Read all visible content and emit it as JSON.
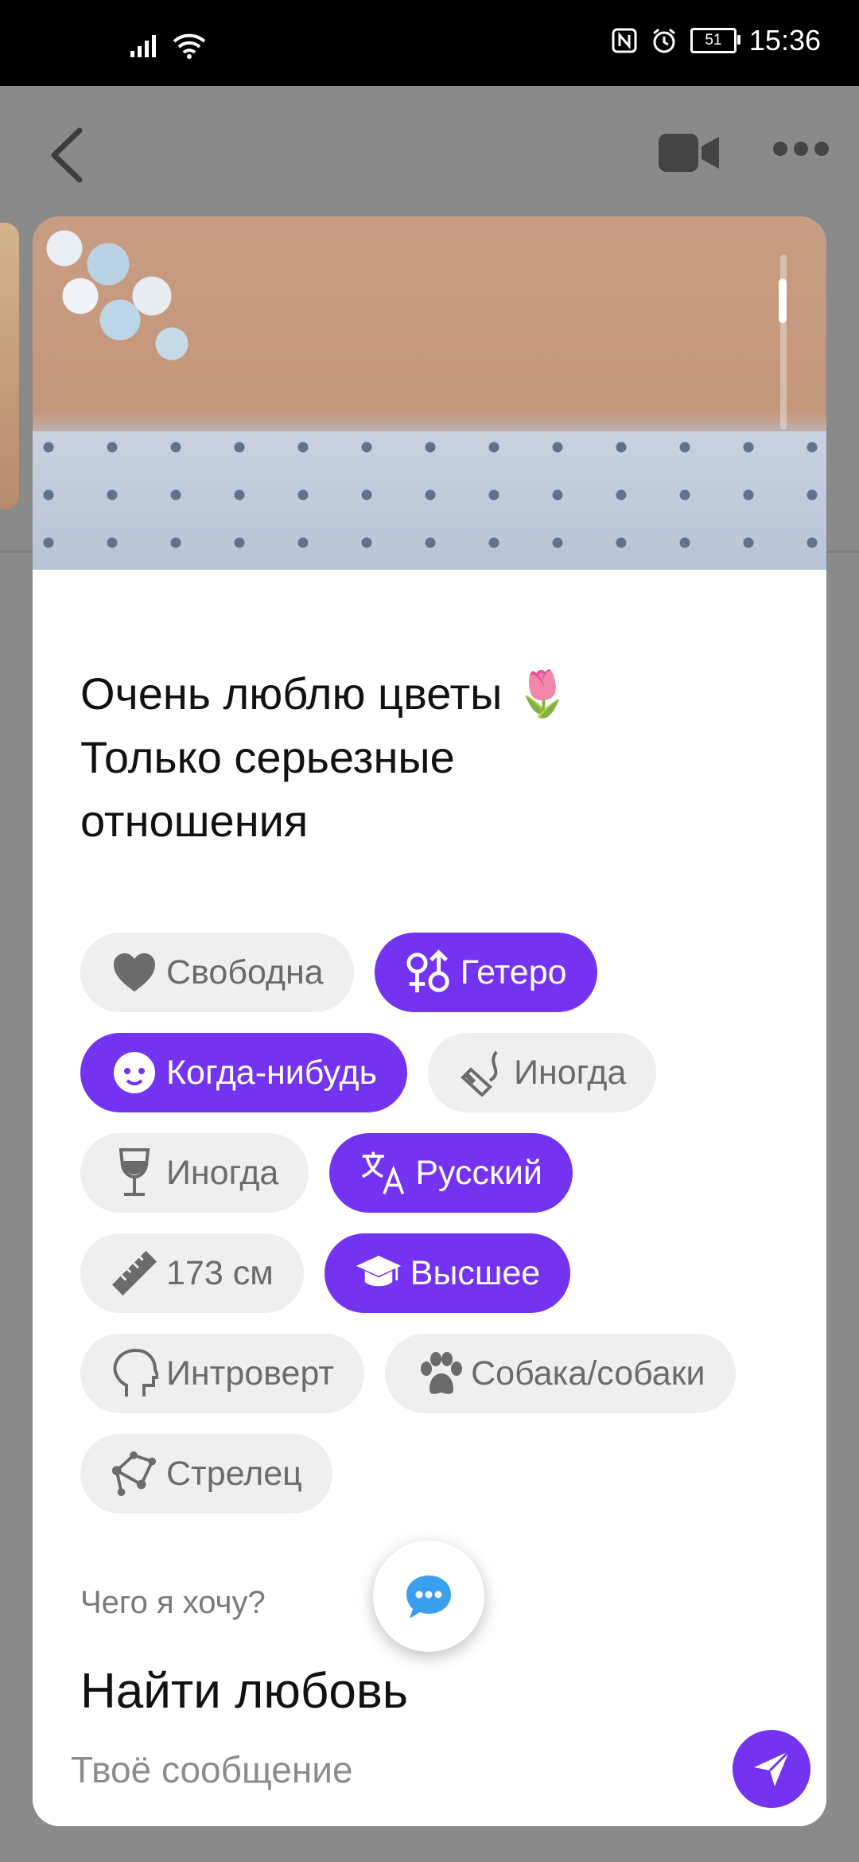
{
  "status_bar": {
    "time": "15:36",
    "battery_level": "51"
  },
  "profile": {
    "bio": "Очень люблю цветы 🌷\nТолько серьезные\nотношения",
    "tags": [
      {
        "label": "Свободна",
        "icon": "heart-icon",
        "highlighted": false
      },
      {
        "label": "Гетеро",
        "icon": "gender-icon",
        "highlighted": true
      },
      {
        "label": "Когда-нибудь",
        "icon": "baby-icon",
        "highlighted": true
      },
      {
        "label": "Иногда",
        "icon": "smoking-icon",
        "highlighted": false
      },
      {
        "label": "Иногда",
        "icon": "wine-glass-icon",
        "highlighted": false
      },
      {
        "label": "Русский",
        "icon": "translate-icon",
        "highlighted": true
      },
      {
        "label": "173 см",
        "icon": "ruler-icon",
        "highlighted": false
      },
      {
        "label": "Высшее",
        "icon": "graduation-cap-icon",
        "highlighted": true
      },
      {
        "label": "Интроверт",
        "icon": "head-profile-icon",
        "highlighted": false
      },
      {
        "label": "Собака/собаки",
        "icon": "paw-icon",
        "highlighted": false
      },
      {
        "label": "Стрелец",
        "icon": "constellation-icon",
        "highlighted": false
      }
    ],
    "want_label": "Чего я хочу?",
    "want_value": "Найти любовь"
  },
  "composer": {
    "placeholder": "Твоё сообщение"
  },
  "colors": {
    "accent": "#7433f0",
    "chip_bg": "#efefef",
    "chip_text": "#6b6b6b",
    "overlay": "#8a8a8a"
  }
}
